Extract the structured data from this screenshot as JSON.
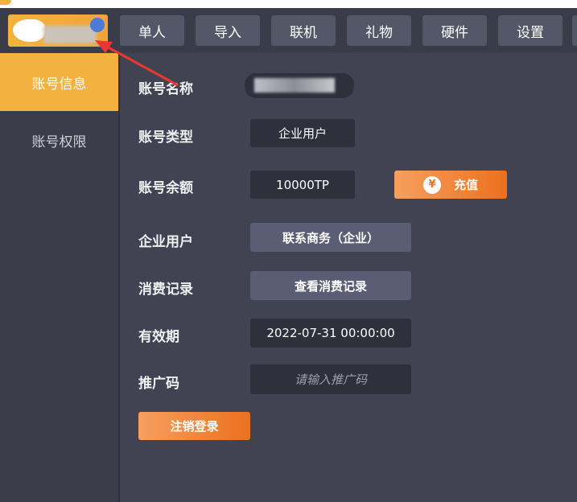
{
  "colors": {
    "accent": "#f3b13f",
    "orange_gradient_start": "#f6a05f",
    "orange_gradient_end": "#ec701d",
    "annotation_arrow": "#e8382f"
  },
  "nav": {
    "items": [
      {
        "label": "单人"
      },
      {
        "label": "导入"
      },
      {
        "label": "联机"
      },
      {
        "label": "礼物"
      },
      {
        "label": "硬件"
      },
      {
        "label": "设置"
      }
    ]
  },
  "sidebar": {
    "items": [
      {
        "label": "账号信息",
        "active": true
      },
      {
        "label": "账号权限",
        "active": false
      }
    ]
  },
  "account": {
    "name_label": "账号名称",
    "type_label": "账号类型",
    "type_value": "企业用户",
    "balance_label": "账号余额",
    "balance_value": "10000TP",
    "recharge_label": "充值",
    "recharge_icon": "money-bag-icon",
    "enterprise_label": "企业用户",
    "contact_label": "联系商务（企业）",
    "records_label": "消费记录",
    "view_records_label": "查看消费记录",
    "expiry_label": "有效期",
    "expiry_value": "2022-07-31 00:00:00",
    "promo_label": "推广码",
    "promo_placeholder": "请输入推广码",
    "logout_label": "注销登录"
  }
}
